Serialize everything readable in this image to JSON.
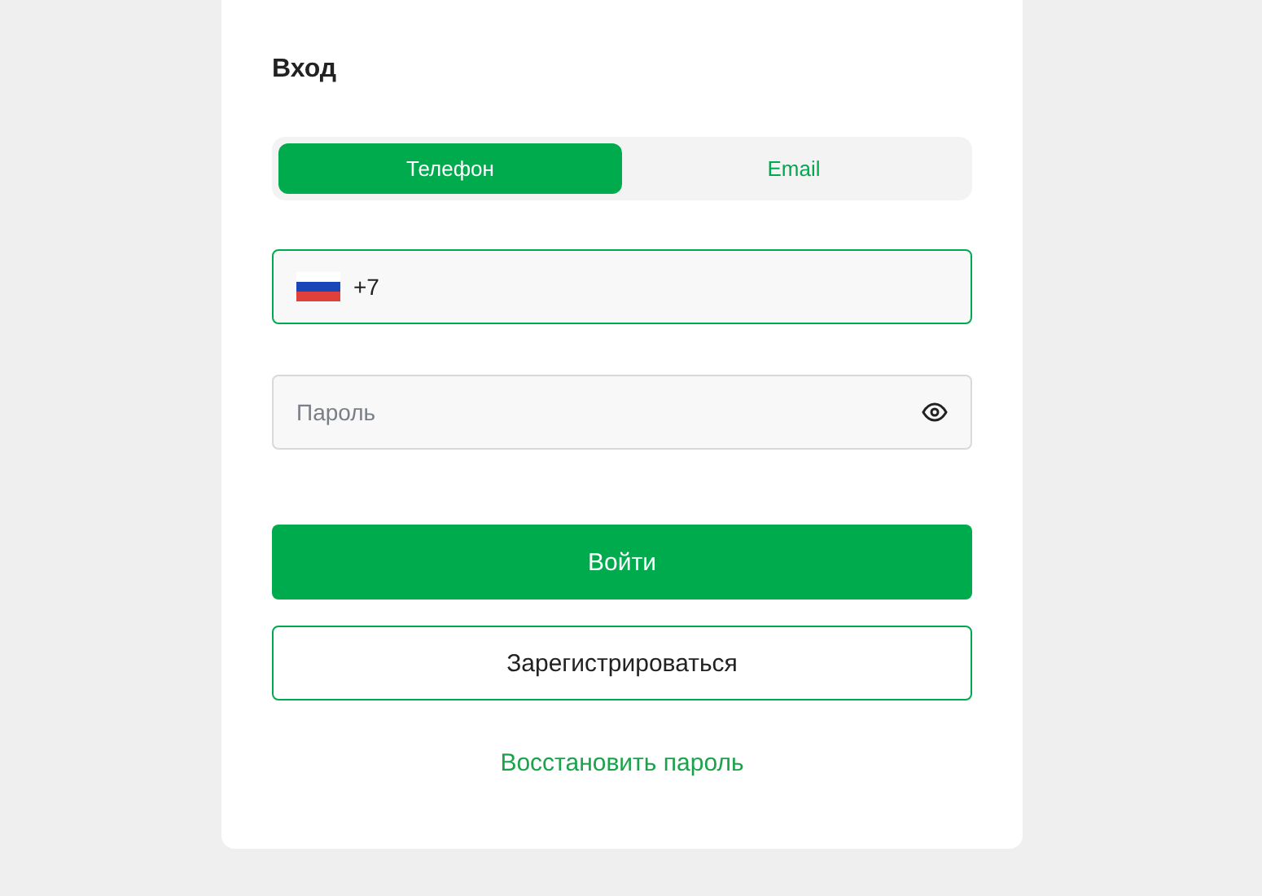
{
  "title": "Вход",
  "tabs": [
    {
      "label": "Телефон",
      "selected": true
    },
    {
      "label": "Email",
      "selected": false
    }
  ],
  "phone": {
    "value": "+7",
    "focused": true
  },
  "password": {
    "placeholder": "Пароль",
    "focused": false
  },
  "buttons": [
    {
      "label": "Войти",
      "kind": "primary"
    },
    {
      "label": "Зарегистрироваться",
      "kind": "outline"
    }
  ],
  "link": "Восстановить пароль"
}
